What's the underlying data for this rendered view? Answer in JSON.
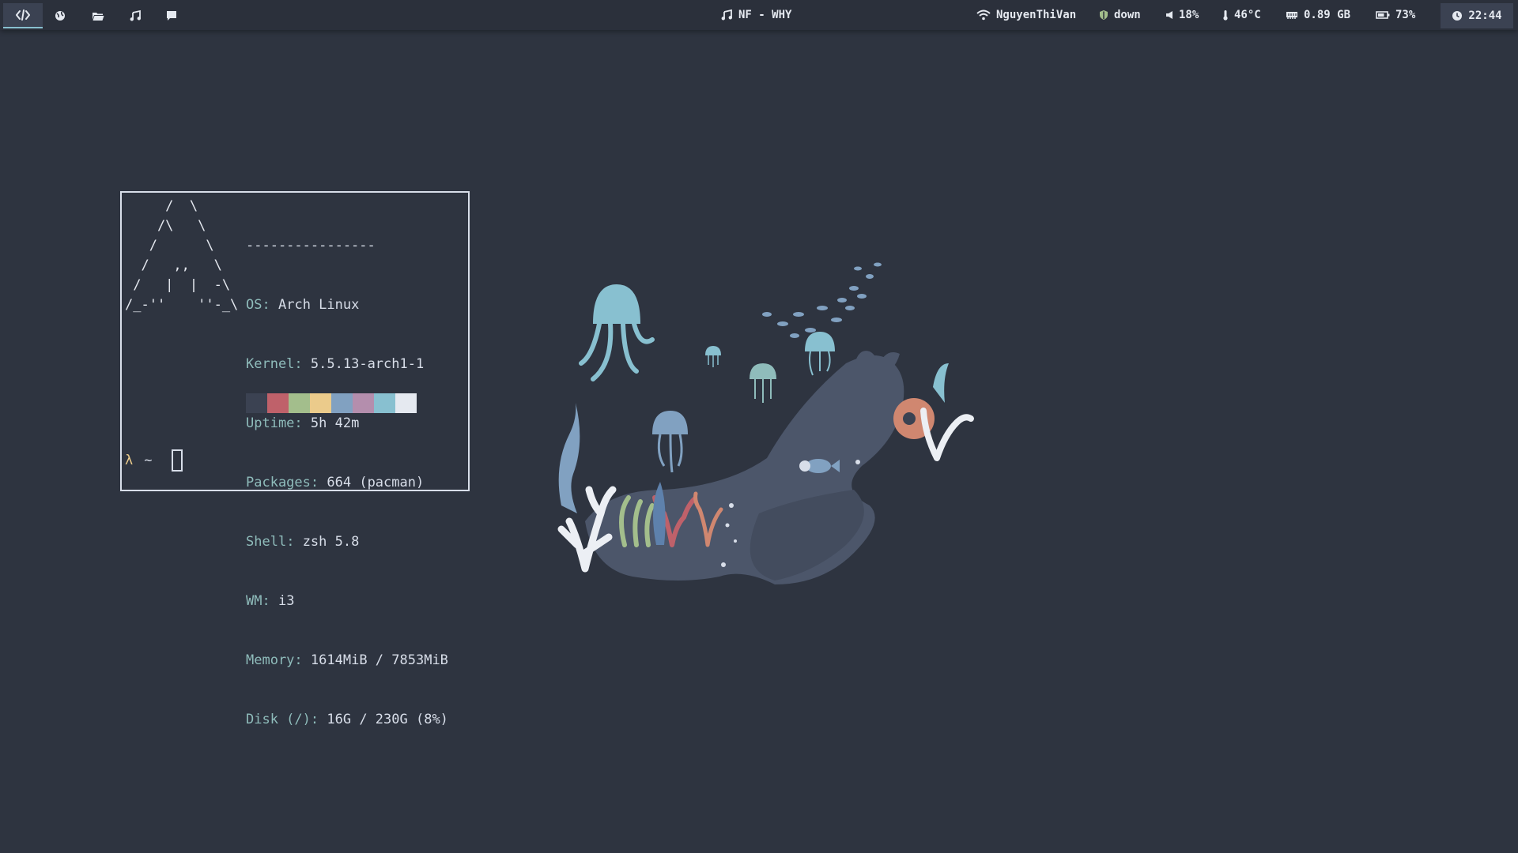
{
  "colors": {
    "background": "#2e3440",
    "bar": "#2b303b",
    "accent": "#88c0d0",
    "text": "#e5e9f0"
  },
  "bar": {
    "workspaces": [
      {
        "icon": "code-icon",
        "active": true
      },
      {
        "icon": "globe-icon",
        "active": false
      },
      {
        "icon": "folder-icon",
        "active": false
      },
      {
        "icon": "music-note-icon",
        "active": false
      },
      {
        "icon": "chat-bubble-icon",
        "active": false
      }
    ],
    "now_playing": {
      "icon": "music-note-icon",
      "text": "NF - WHY"
    },
    "wifi": {
      "icon": "wifi-icon",
      "text": "NguyenThiVan"
    },
    "vpn": {
      "icon": "shield-icon",
      "text": "down"
    },
    "volume": {
      "icon": "speaker-icon",
      "text": "18%"
    },
    "temperature": {
      "icon": "thermometer-icon",
      "text": "46°C"
    },
    "memory": {
      "icon": "memory-chip-icon",
      "text": "0.89 GB"
    },
    "battery": {
      "icon": "battery-icon",
      "text": "73%"
    },
    "clock": {
      "icon": "clock-icon",
      "text": "22:44"
    }
  },
  "terminal": {
    "separator": "----------------",
    "info": [
      {
        "key": "OS",
        "value": "Arch Linux"
      },
      {
        "key": "Kernel",
        "value": "5.5.13-arch1-1"
      },
      {
        "key": "Uptime",
        "value": "5h 42m"
      },
      {
        "key": "Packages",
        "value": "664 (pacman)"
      },
      {
        "key": "Shell",
        "value": "zsh 5.8"
      },
      {
        "key": "WM",
        "value": "i3"
      },
      {
        "key": "Memory",
        "value": "1614MiB / 7853MiB"
      },
      {
        "key": "Disk (/)",
        "value": "16G / 230G (8%)"
      }
    ],
    "palette": [
      "#3b4252",
      "#bf616a",
      "#a3be8c",
      "#ebcb8b",
      "#81a1c1",
      "#b48ead",
      "#88c0d0",
      "#e5e9f0"
    ],
    "prompt_symbol": "λ",
    "prompt_path": "~"
  }
}
